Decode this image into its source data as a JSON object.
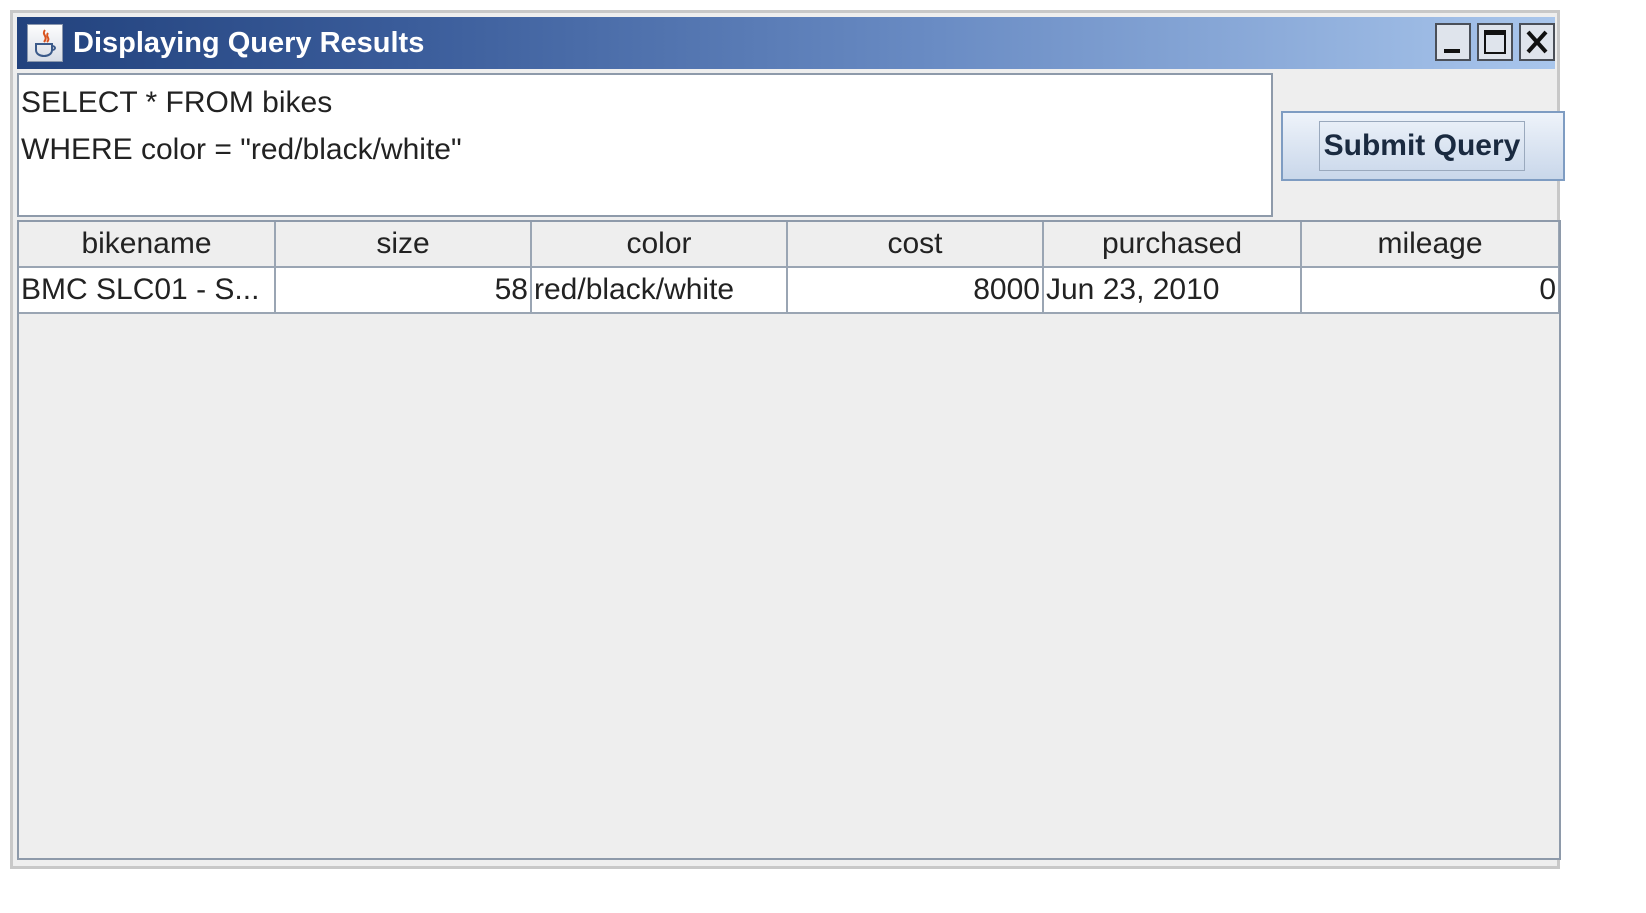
{
  "window": {
    "title": "Displaying Query Results",
    "controls": [
      "minimize",
      "maximize",
      "close"
    ]
  },
  "query": {
    "text": "SELECT * FROM bikes\nWHERE color = \"red/black/white\""
  },
  "toolbar": {
    "submit_label": "Submit Query"
  },
  "table": {
    "columns": [
      "bikename",
      "size",
      "color",
      "cost",
      "purchased",
      "mileage"
    ],
    "rows": [
      [
        "BMC SLC01 - S...",
        "58",
        "red/black/white",
        "8000",
        "Jun 23, 2010",
        "0"
      ]
    ]
  },
  "colors": {
    "titlebar_start": "#22427d",
    "titlebar_end": "#a9c6ec",
    "window_bg": "#eeeeee",
    "grid_line": "#9aa5b3"
  }
}
